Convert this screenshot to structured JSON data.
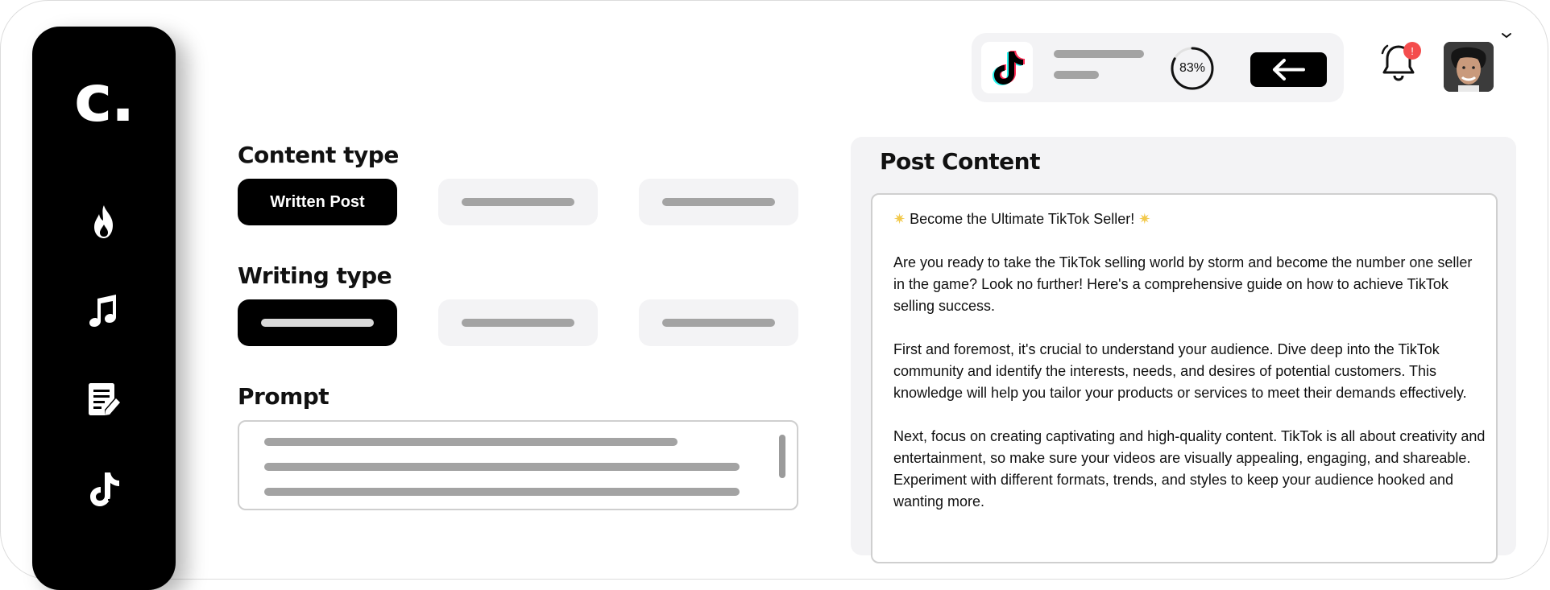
{
  "sidebar": {
    "logo": "c.",
    "items": [
      {
        "icon": "flame-icon"
      },
      {
        "icon": "music-note-icon"
      },
      {
        "icon": "document-edit-icon"
      },
      {
        "icon": "tiktok-icon"
      }
    ]
  },
  "content_type": {
    "title": "Content type",
    "options": [
      {
        "label": "Written Post",
        "selected": true
      },
      {
        "label": "",
        "selected": false
      },
      {
        "label": "",
        "selected": false
      }
    ]
  },
  "writing_type": {
    "title": "Writing type",
    "options": [
      {
        "label": "",
        "selected": true
      },
      {
        "label": "",
        "selected": false
      },
      {
        "label": "",
        "selected": false
      }
    ]
  },
  "prompt": {
    "title": "Prompt"
  },
  "topbar": {
    "platform_icon": "tiktok-icon",
    "progress_text": "83%",
    "progress_value": 0.83,
    "back_icon": "arrow-left-icon",
    "notification_count": "!"
  },
  "post": {
    "title": "Post Content",
    "headline": "Become the Ultimate TikTok Seller!",
    "paragraphs": [
      "Are you ready to take the TikTok selling world by storm and become the number one seller in the game? Look no further! Here's a comprehensive guide on how to achieve TikTok selling success.",
      "First and foremost, it's crucial to understand your audience. Dive deep into the TikTok community and identify the interests, needs, and desires of potential customers. This knowledge will help you tailor your products or services to meet their demands effectively.",
      "Next, focus on creating captivating and high-quality content. TikTok is all about creativity and entertainment, so make sure your videos are visually appealing, engaging, and shareable. Experiment with different formats, trends, and styles to keep your audience hooked and wanting more."
    ]
  },
  "colors": {
    "accent": "#000000",
    "panel": "#f3f3f5",
    "placeholder": "#a3a3a3",
    "badge": "#f44d4d"
  }
}
